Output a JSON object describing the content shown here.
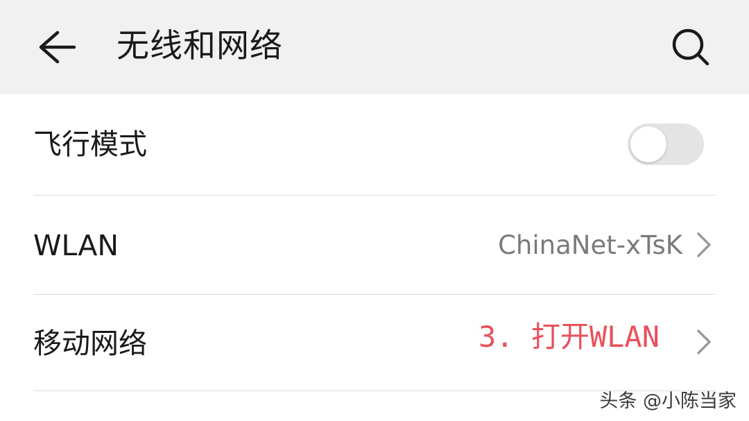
{
  "header": {
    "title": "无线和网络",
    "back_icon": "arrow-left-icon",
    "search_icon": "search-icon",
    "background_color": "#f1f1f1"
  },
  "settings": {
    "airplane_mode": {
      "label": "飞行模式",
      "enabled": false
    },
    "wlan": {
      "label": "WLAN",
      "value": "ChinaNet-xTsK"
    },
    "mobile_network": {
      "label": "移动网络"
    }
  },
  "annotation": {
    "text": "3. 打开WLAN",
    "color": "#e8505b"
  },
  "watermark": {
    "text": "头条 @小陈当家"
  }
}
